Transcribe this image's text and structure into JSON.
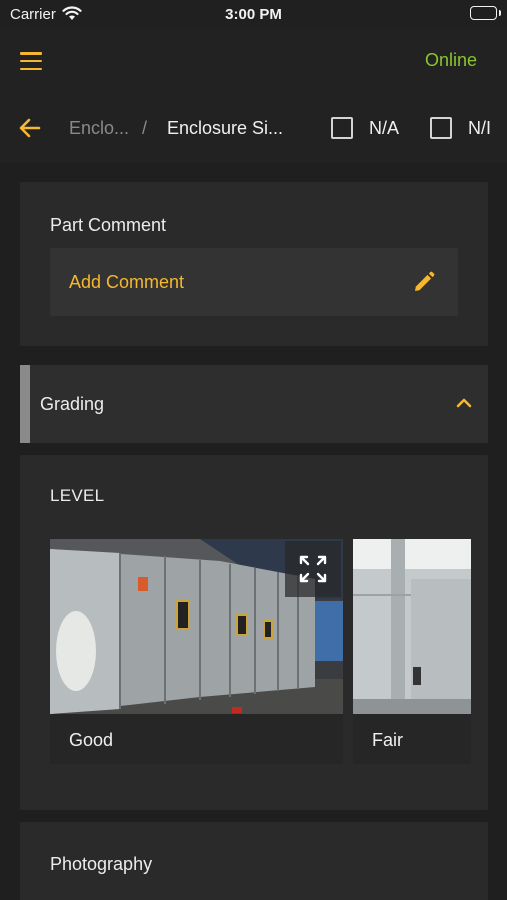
{
  "status_bar": {
    "carrier": "Carrier",
    "time": "3:00 PM"
  },
  "header": {
    "status": "Online",
    "status_color": "#8ac531",
    "breadcrumb": {
      "parent": "Enclo...",
      "separator": "/",
      "current": "Enclosure Si..."
    },
    "checkboxes": [
      {
        "label": "N/A",
        "checked": false
      },
      {
        "label": "N/I",
        "checked": false
      }
    ]
  },
  "part_comment": {
    "title": "Part Comment",
    "action_label": "Add Comment",
    "action_icon": "pencil-icon"
  },
  "grading": {
    "title": "Grading",
    "expanded": true,
    "icon": "chevron-up-icon"
  },
  "level": {
    "title": "LEVEL",
    "options": [
      {
        "label": "Good",
        "icon": "expand-icon"
      },
      {
        "label": "Fair"
      }
    ]
  },
  "photography": {
    "title": "Photography"
  },
  "colors": {
    "accent": "#f5b82e",
    "background": "#1f1f1f",
    "card": "#2a2a2a"
  }
}
